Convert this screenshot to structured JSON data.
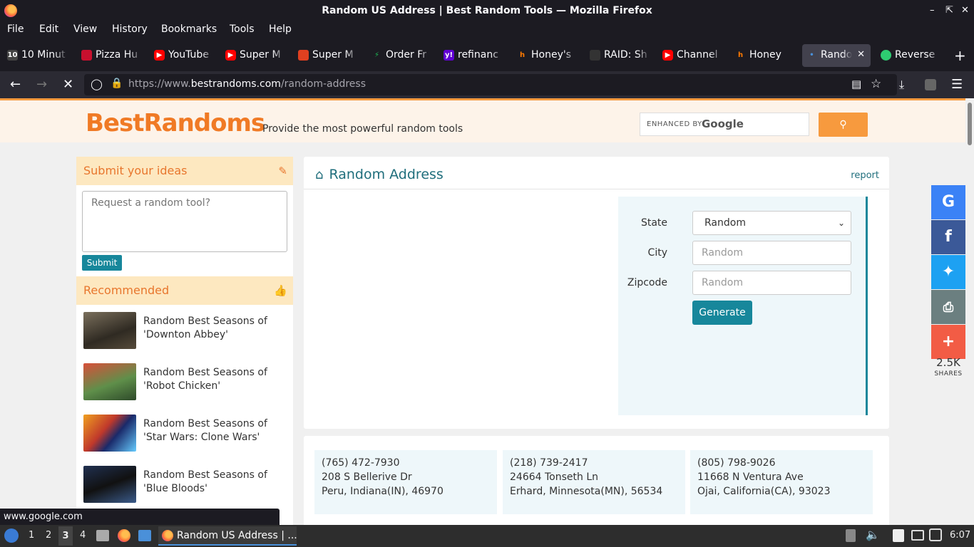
{
  "window": {
    "title": "Random US Address | Best Random Tools — Mozilla Firefox"
  },
  "menu": [
    "File",
    "Edit",
    "View",
    "History",
    "Bookmarks",
    "Tools",
    "Help"
  ],
  "tabs": [
    {
      "label": "10 Minut",
      "icon": "ten-minute-mail-icon",
      "color": "#444"
    },
    {
      "label": "Pizza Hu",
      "icon": "pizza-hut-icon",
      "color": "#c8102e"
    },
    {
      "label": "YouTube",
      "icon": "youtube-icon",
      "color": "#ff0000"
    },
    {
      "label": "Super M",
      "icon": "youtube-icon",
      "color": "#ff0000"
    },
    {
      "label": "Super M",
      "icon": "mario-icon",
      "color": "#e04020"
    },
    {
      "label": "Order Fr",
      "icon": "bolt-icon",
      "color": "#1db954"
    },
    {
      "label": "refinanc",
      "icon": "yahoo-icon",
      "color": "#6001d2"
    },
    {
      "label": "Honey's",
      "icon": "honey-icon",
      "color": "#ff7a00"
    },
    {
      "label": "RAID: Sh",
      "icon": "raid-icon",
      "color": "#333"
    },
    {
      "label": "Channel",
      "icon": "youtube-icon",
      "color": "#ff0000"
    },
    {
      "label": "Honey",
      "icon": "honey-icon",
      "color": "#ff7a00"
    },
    {
      "label": "Rando",
      "icon": "bestrandoms-icon",
      "color": "#2b6cb0"
    },
    {
      "label": "Reverse",
      "icon": "reverse-icon",
      "color": "#2ecc71"
    }
  ],
  "url": {
    "prefix": "https://www.",
    "domain": "bestrandoms.com",
    "path": "/random-address"
  },
  "site": {
    "logo": "BestRandoms",
    "tagline": "Provide the most powerful random tools",
    "search_enhanced": "ENHANCED BY",
    "search_google": "Google"
  },
  "sidebar": {
    "submit_title": "Submit your ideas",
    "idea_placeholder": "Request a random tool?",
    "submit_label": "Submit",
    "recommended_title": "Recommended",
    "items": [
      {
        "title": "Random Best Seasons of 'Downton Abbey'"
      },
      {
        "title": "Random Best Seasons of 'Robot Chicken'"
      },
      {
        "title": "Random Best Seasons of 'Star Wars: Clone Wars'"
      },
      {
        "title": "Random Best Seasons of 'Blue Bloods'"
      }
    ]
  },
  "panel": {
    "title": "Random Address",
    "report": "report",
    "state_label": "State",
    "state_value": "Random",
    "city_label": "City",
    "city_placeholder": "Random",
    "zip_label": "Zipcode",
    "zip_placeholder": "Random",
    "generate": "Generate"
  },
  "results": [
    {
      "phone": "(765) 472-7930",
      "street": "208 S Bellerive Dr",
      "city": "Peru, Indiana(IN), 46970"
    },
    {
      "phone": "(218) 739-2417",
      "street": "24664 Tonseth Ln",
      "city": "Erhard, Minnesota(MN), 56534"
    },
    {
      "phone": "(805) 798-9026",
      "street": "11668 N Ventura Ave",
      "city": "Ojai, California(CA), 93023"
    }
  ],
  "share": {
    "count": "2.5K",
    "label": "SHARES",
    "colors": {
      "google": "#3b82f6",
      "facebook": "#3b5998",
      "twitter": "#1da1f2",
      "print": "#6b7f80",
      "more": "#f25c45"
    }
  },
  "status_url": "www.google.com",
  "taskbar": {
    "workspaces": [
      "1",
      "2",
      "3",
      "4"
    ],
    "task": "Random US Address | ...",
    "time": "6:07"
  }
}
